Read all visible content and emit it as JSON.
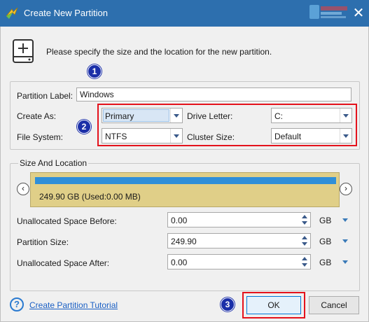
{
  "window": {
    "title": "Create New Partition",
    "close_glyph": "✕"
  },
  "intro": "Please specify the size and the location for the new partition.",
  "badges": [
    "1",
    "2",
    "3"
  ],
  "partition_label": {
    "label": "Partition Label:",
    "value": "Windows"
  },
  "create_as": {
    "label": "Create As:",
    "value": "Primary"
  },
  "drive_letter": {
    "label": "Drive Letter:",
    "value": "C:"
  },
  "file_system": {
    "label": "File System:",
    "value": "NTFS"
  },
  "cluster_size": {
    "label": "Cluster Size:",
    "value": "Default"
  },
  "size_location": {
    "legend": "Size And Location",
    "partition_caption": "249.90 GB (Used:0.00 MB)",
    "prev_glyph": "‹",
    "next_glyph": "›"
  },
  "fields": {
    "space_before": {
      "label": "Unallocated Space Before:",
      "value": "0.00",
      "unit": "GB"
    },
    "partition_size": {
      "label": "Partition Size:",
      "value": "249.90",
      "unit": "GB"
    },
    "space_after": {
      "label": "Unallocated Space After:",
      "value": "0.00",
      "unit": "GB"
    }
  },
  "footer": {
    "help_glyph": "?",
    "tutorial_link": "Create Partition Tutorial",
    "ok_label": "OK",
    "cancel_label": "Cancel"
  },
  "colors": {
    "titlebar": "#2d6fae",
    "highlight_red": "#e4121c",
    "badge_blue": "#1b2fa8",
    "partition_fill": "#e0cf88",
    "partition_used": "#2f8fd8",
    "link": "#1a5fc4"
  },
  "icons": [
    "app-icon",
    "close-icon",
    "disk-add-icon",
    "help-icon",
    "prev-arrow-icon",
    "next-arrow-icon"
  ]
}
